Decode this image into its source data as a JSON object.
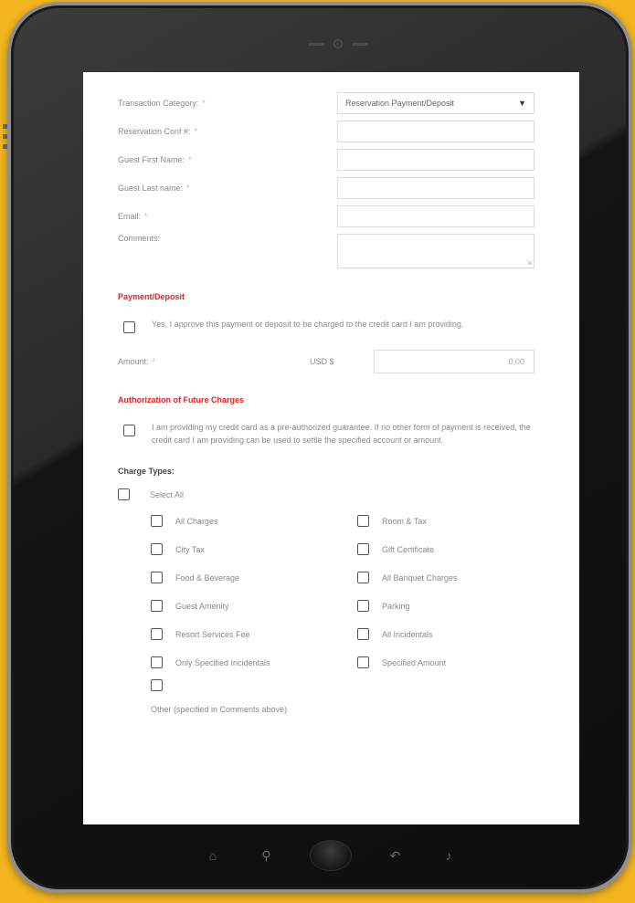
{
  "form": {
    "fields": [
      {
        "label": "Transaction Category:",
        "required": "*",
        "type": "select",
        "value": "Reservation Payment/Deposit"
      },
      {
        "label": "Reservation Conf #:",
        "required": "*",
        "type": "text",
        "value": ""
      },
      {
        "label": "Guest First Name:",
        "required": "*",
        "type": "text",
        "value": ""
      },
      {
        "label": "Guest Last name:",
        "required": "*",
        "type": "text",
        "value": ""
      },
      {
        "label": "Email:",
        "required": "*",
        "type": "text",
        "value": ""
      },
      {
        "label": "Comments:",
        "required": "",
        "type": "textarea",
        "value": ""
      }
    ],
    "payment": {
      "title": "Payment/Deposit",
      "consent": "Yes, I approve this payment or deposit to be charged to the credit card I am providing.",
      "amount_label": "Amount:",
      "amount_required": "*",
      "currency": "USD $",
      "amount_value": "0.00"
    },
    "authorization": {
      "title": "Authorization of Future Charges",
      "consent": "I am providing my credit card as a pre-authorized guarantee. If no other form of payment is received, the credit card I am providing can be used to settle the specified account or amount."
    },
    "charge_types": {
      "title": "Charge Types:",
      "select_all": "Select All",
      "options": [
        "All Charges",
        "Room & Tax",
        "City Tax",
        "Gift Certificate",
        "Food & Beverage",
        "All Banquet Charges",
        "Guest Amenity",
        "Parking",
        "Resort Services Fee",
        "All Incidentals",
        "Only Specified Incidentals",
        "Specified Amount"
      ],
      "other": "Other (specified in Comments above)"
    }
  },
  "colors": {
    "background": "#f2b51f",
    "section_title": "#e02424",
    "device": "#141414"
  },
  "icons": {
    "nav": [
      "home-icon",
      "search-icon",
      "home-button",
      "back-icon",
      "volume-icon"
    ]
  }
}
